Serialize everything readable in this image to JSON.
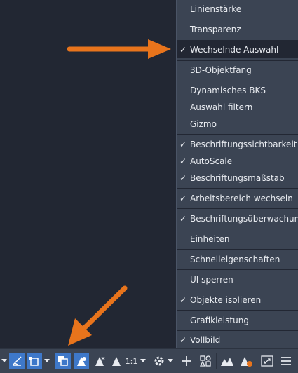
{
  "menu": {
    "items": [
      {
        "label": "Linienstärke",
        "checked": false
      },
      {
        "label": "Transparenz",
        "checked": false
      },
      {
        "label": "Wechselnde Auswahl",
        "checked": true,
        "highlighted": true
      },
      {
        "label": "3D-Objektfang",
        "checked": false
      },
      {
        "label": "Dynamisches BKS",
        "checked": false
      },
      {
        "label": "Auswahl filtern",
        "checked": false
      },
      {
        "label": "Gizmo",
        "checked": false
      },
      {
        "label": "Beschriftungssichtbarkeit",
        "checked": true
      },
      {
        "label": "AutoScale",
        "checked": true
      },
      {
        "label": "Beschriftungsmaßstab",
        "checked": true
      },
      {
        "label": "Arbeitsbereich wechseln",
        "checked": true
      },
      {
        "label": "Beschriftungsüberwachung",
        "checked": true
      },
      {
        "label": "Einheiten",
        "checked": false
      },
      {
        "label": "Schnelleigenschaften",
        "checked": false
      },
      {
        "label": "UI sperren",
        "checked": false
      },
      {
        "label": "Objekte isolieren",
        "checked": true
      },
      {
        "label": "Grafikleistung",
        "checked": false
      },
      {
        "label": "Vollbild",
        "checked": true
      }
    ],
    "check_glyph": "✓"
  },
  "statusbar": {
    "annotation_scale": "1:1",
    "dropdown_glyph": "▾"
  },
  "colors": {
    "arrow": "#e8741c",
    "active_button": "#3e78c9",
    "menu_bg": "#3b4453",
    "canvas_bg": "#222733"
  },
  "icons": {
    "menu_check": "check-icon",
    "statusbar": [
      "dropdown-arrow-icon",
      "isometric-drafting-icon",
      "object-snap-tracking-icon",
      "2d-object-snap-icon",
      "selection-cycling-icon",
      "annotation-visibility-icon",
      "autoscale-icon",
      "annotation-scale-dropdown",
      "workspace-switching-icon",
      "annotation-monitor-icon",
      "isolate-objects-icon",
      "hardware-acceleration-icon",
      "clean-screen-icon",
      "customization-menu-icon"
    ]
  }
}
